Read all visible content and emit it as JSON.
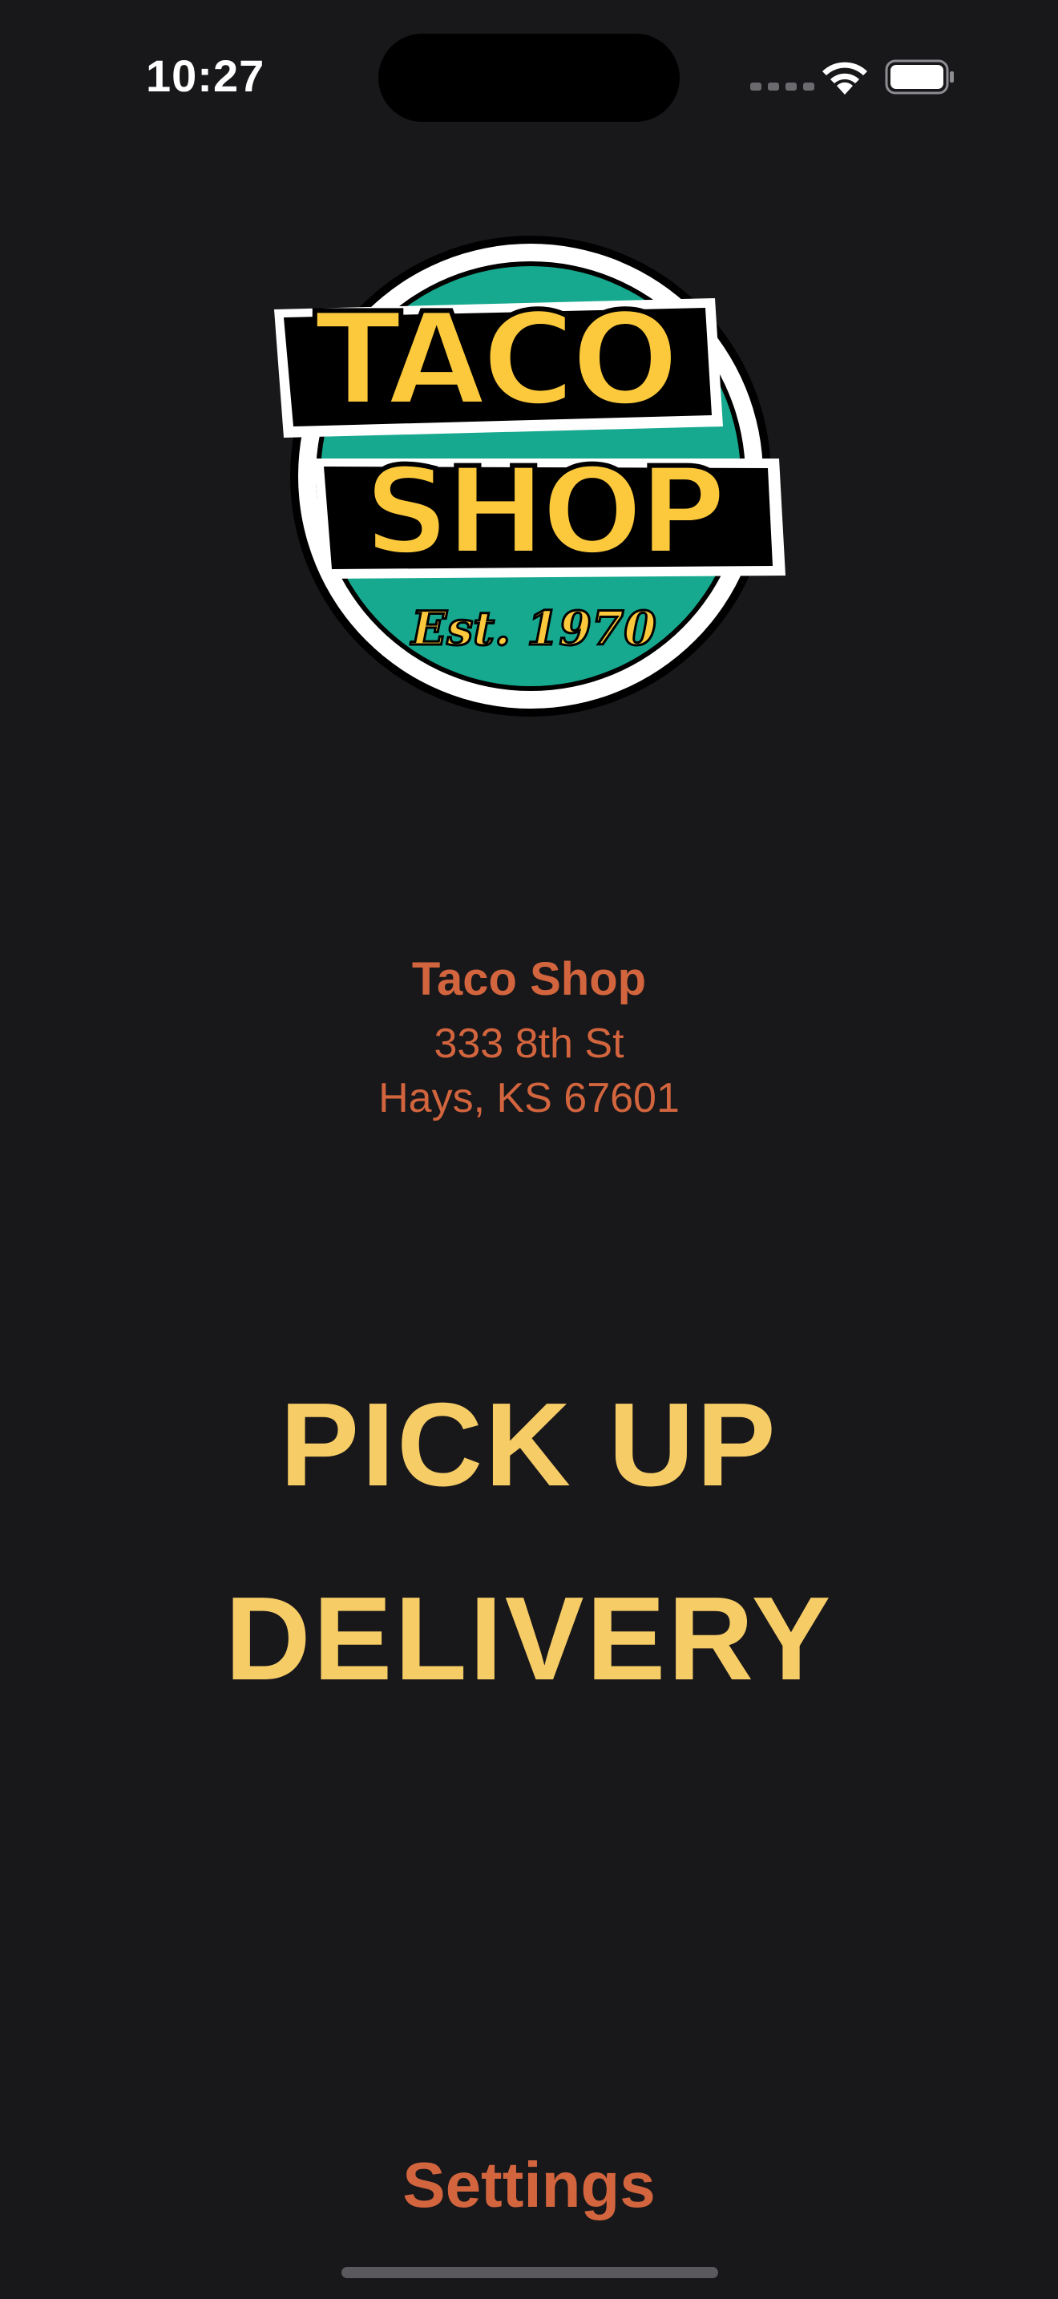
{
  "status_bar": {
    "time": "10:27"
  },
  "logo": {
    "line1": "TACO",
    "line2": "SHOP",
    "tagline": "Est. 1970"
  },
  "store": {
    "name": "Taco Shop",
    "address_line1": "333 8th St",
    "address_line2": "Hays, KS 67601"
  },
  "actions": {
    "pickup_label": "PICK UP",
    "delivery_label": "DELIVERY"
  },
  "footer": {
    "settings_label": "Settings"
  },
  "colors": {
    "background": "#18171a",
    "accent_orange": "#d2653e",
    "accent_yellow": "#f6cc67",
    "logo_teal": "#17a98f",
    "logo_yellow": "#fcc93c"
  }
}
